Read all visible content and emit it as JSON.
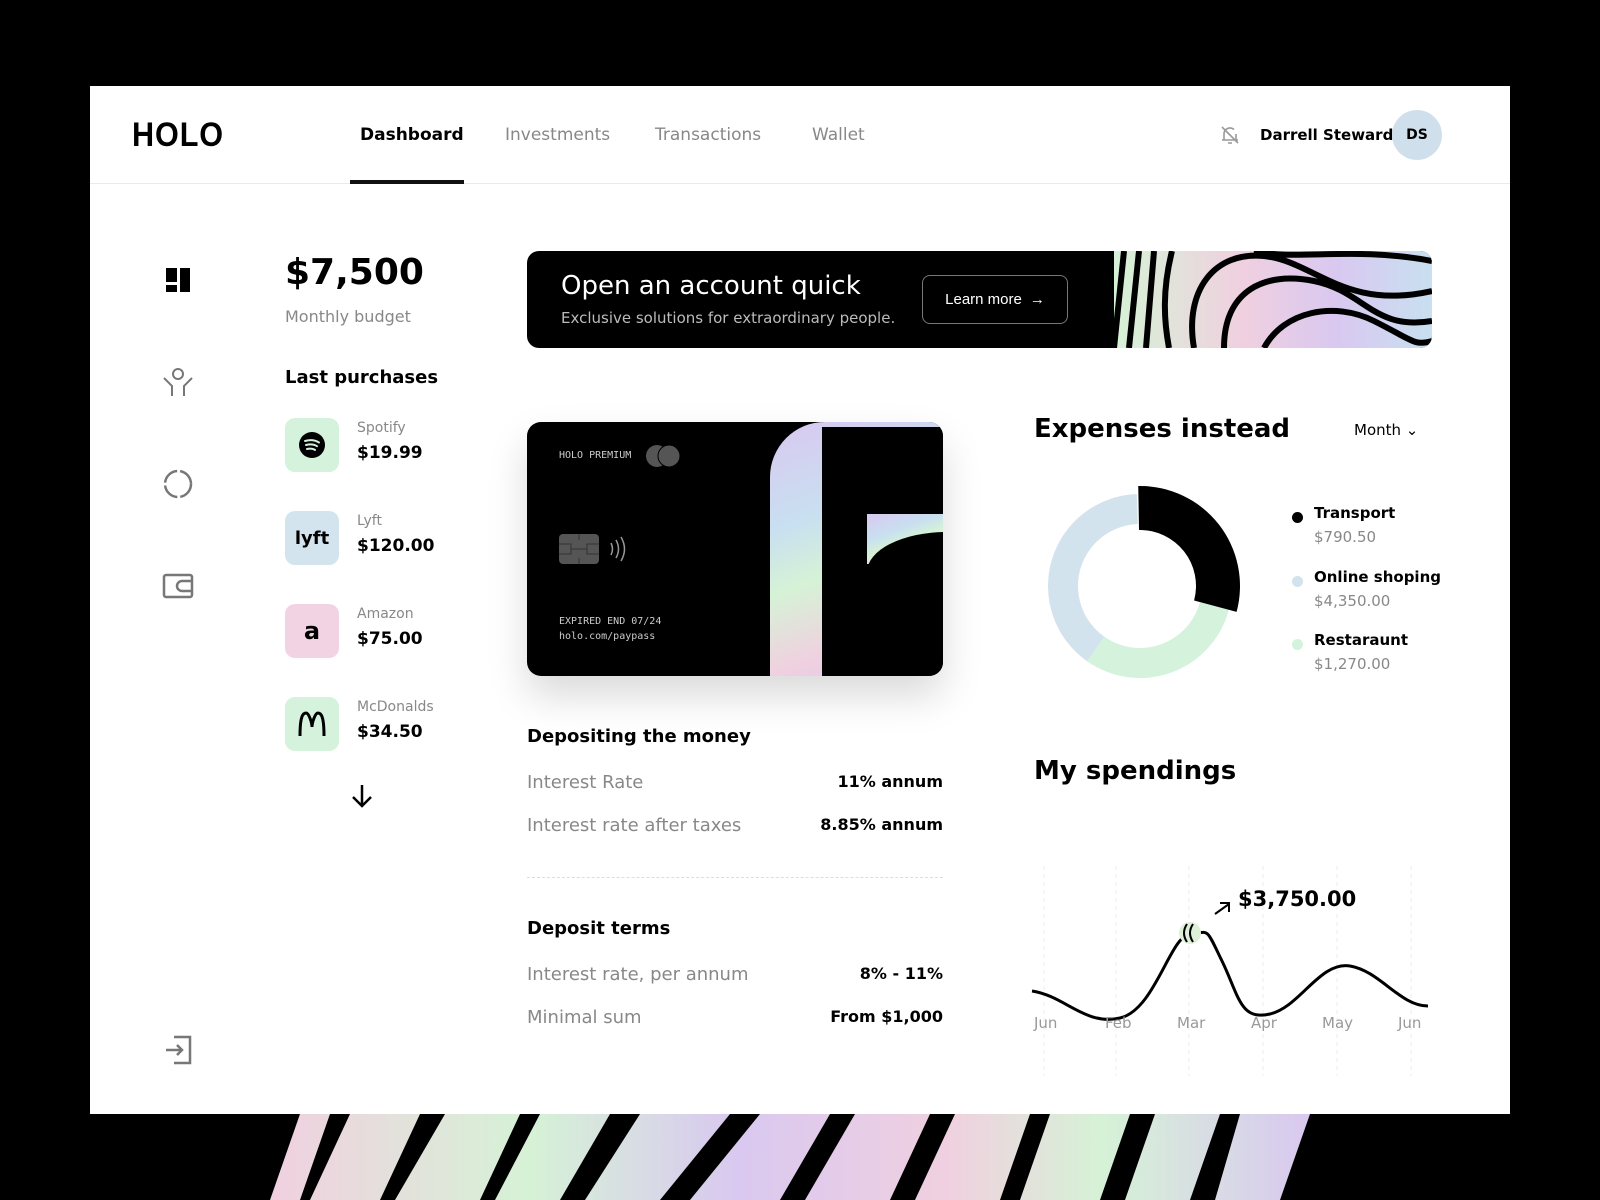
{
  "header": {
    "logo": "HOLO",
    "tabs": [
      {
        "label": "Dashboard",
        "active": true
      },
      {
        "label": "Investments"
      },
      {
        "label": "Transactions"
      },
      {
        "label": "Wallet"
      }
    ],
    "user_name": "Darrell Steward",
    "avatar_initials": "DS",
    "icons": [
      "bell-off-icon"
    ]
  },
  "sidebar": {
    "icons": [
      "dashboard-icon",
      "user-icon",
      "chart-circle-icon",
      "wallet-icon",
      "logout-icon"
    ]
  },
  "budget": {
    "amount": "$7,500",
    "label": "Monthly budget"
  },
  "purchases": {
    "title": "Last purchases",
    "items": [
      {
        "name": "Spotify",
        "amount": "$19.99",
        "icon": "spotify-icon",
        "color": "#d4f2dc"
      },
      {
        "name": "Lyft",
        "amount": "$120.00",
        "icon": "lyft-icon",
        "color": "#d3e4ef"
      },
      {
        "name": "Amazon",
        "amount": "$75.00",
        "icon": "amazon-icon",
        "color": "#f2d3e3"
      },
      {
        "name": "McDonalds",
        "amount": "$34.50",
        "icon": "mcdonalds-icon",
        "color": "#d4f2dc"
      }
    ]
  },
  "banner": {
    "title": "Open an account quick",
    "subtitle": "Exclusive solutions for extraordinary people.",
    "button": "Learn more"
  },
  "card": {
    "brand": "HOLO PREMIUM",
    "expiry": "EXPIRED END 07/24",
    "url": "holo.com/paypass"
  },
  "depositing": {
    "title": "Depositing the money",
    "rows": [
      {
        "label": "Interest Rate",
        "value": "11% annum"
      },
      {
        "label": "Interest rate after taxes",
        "value": "8.85% annum"
      }
    ]
  },
  "terms": {
    "title": "Deposit terms",
    "rows": [
      {
        "label": "Interest rate, per annum",
        "value": "8% - 11%"
      },
      {
        "label": "Minimal sum",
        "value": "From $1,000"
      }
    ]
  },
  "expenses": {
    "title": "Expenses instead",
    "period": "Month",
    "items": [
      {
        "name": "Transport",
        "amount": "$790.50",
        "color": "#000000"
      },
      {
        "name": "Online shoping",
        "amount": "$4,350.00",
        "color": "#d3e3ee"
      },
      {
        "name": "Restaraunt",
        "amount": "$1,270.00",
        "color": "#d4f2dc"
      }
    ]
  },
  "spendings": {
    "title": "My spendings",
    "highlight": "$3,750.00",
    "months": [
      "Jun",
      "Feb",
      "Mar",
      "Apr",
      "May",
      "Jun"
    ]
  }
}
